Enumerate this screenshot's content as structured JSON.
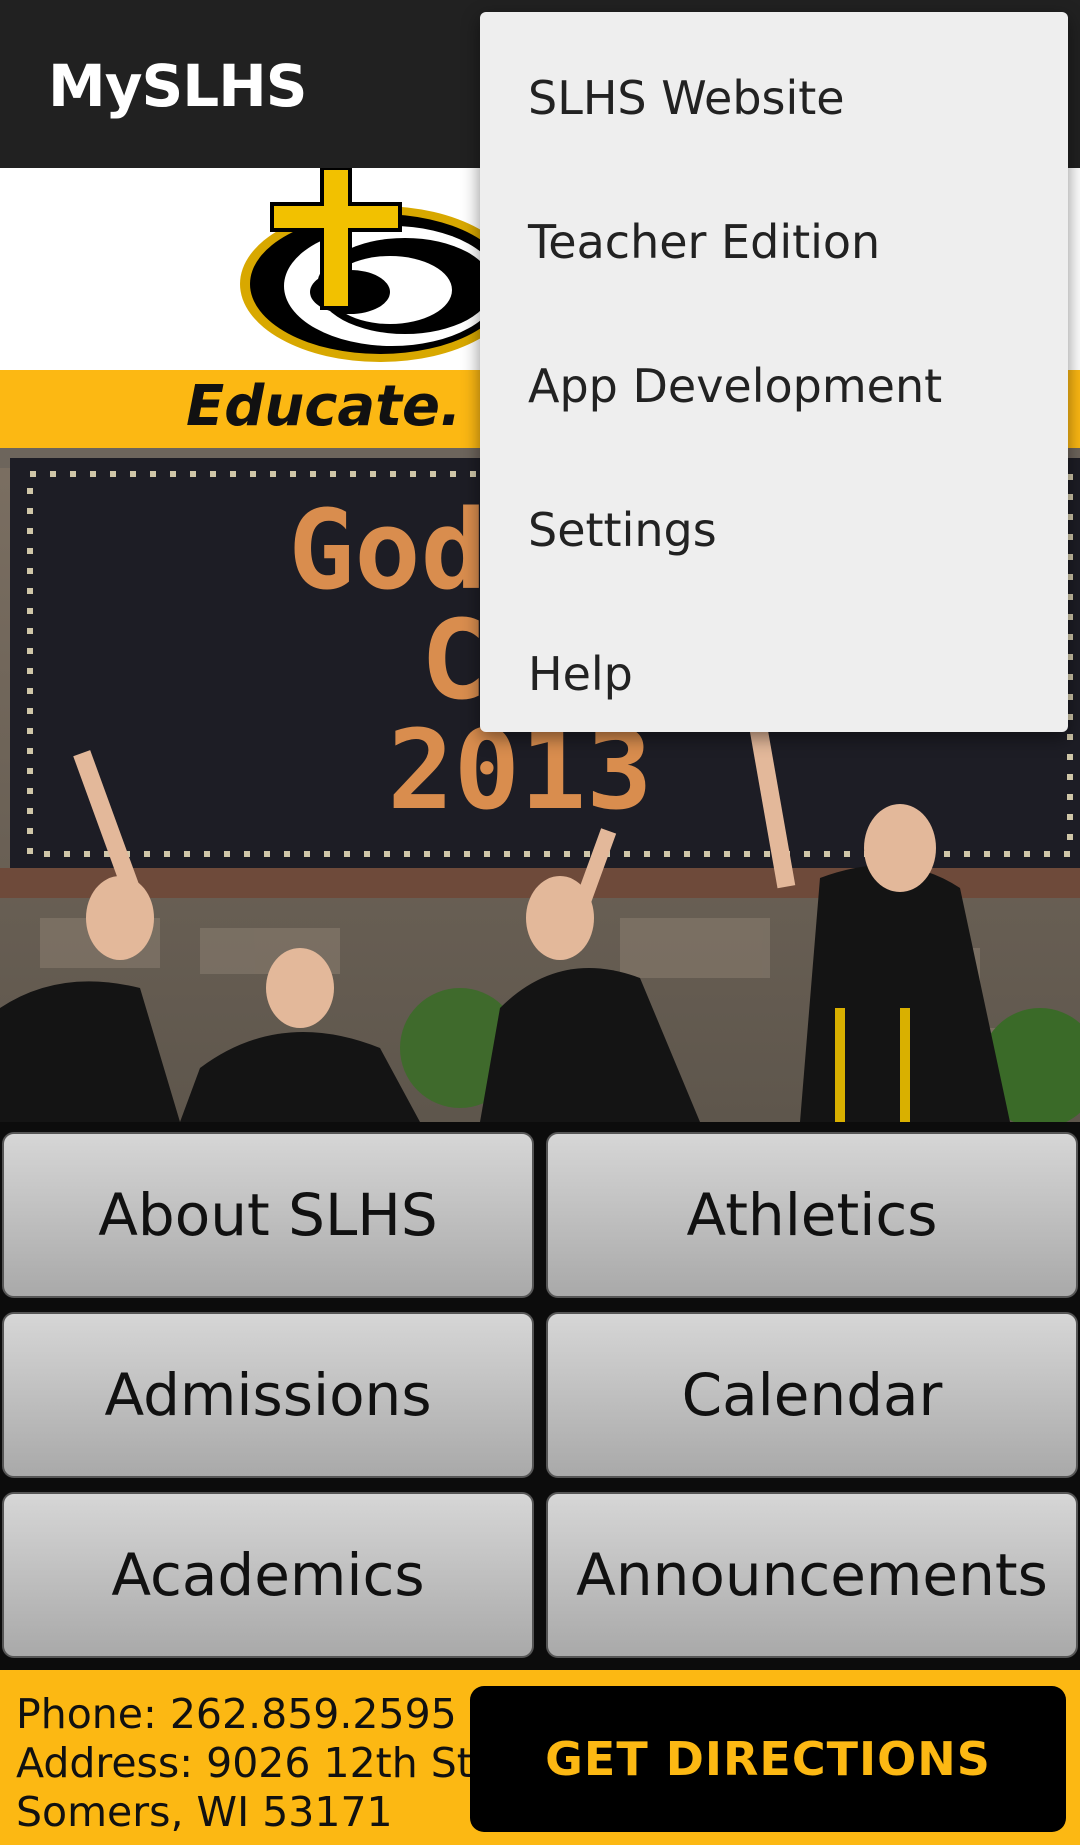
{
  "app": {
    "title": "MySLHS"
  },
  "banner": {
    "tagline": "Educate. Equip."
  },
  "hero": {
    "sign_line1": "God's B",
    "sign_line2": "CLA",
    "sign_line3": "2013"
  },
  "nav_buttons": [
    {
      "label": "About SLHS"
    },
    {
      "label": "Athletics"
    },
    {
      "label": "Admissions"
    },
    {
      "label": "Calendar"
    },
    {
      "label": "Academics"
    },
    {
      "label": "Announcements"
    }
  ],
  "footer": {
    "phone": "Phone: 262.859.2595",
    "address": "Address: 9026 12th St.",
    "city": "Somers, WI 53171",
    "directions_label": "GET DIRECTIONS"
  },
  "overflow_menu": {
    "items": [
      {
        "label": "SLHS Website"
      },
      {
        "label": "Teacher Edition"
      },
      {
        "label": "App Development"
      },
      {
        "label": "Settings"
      },
      {
        "label": "Help"
      }
    ]
  },
  "colors": {
    "appbar": "#212121",
    "accent_gold": "#fcb813",
    "menu_bg": "#eeeeee"
  }
}
